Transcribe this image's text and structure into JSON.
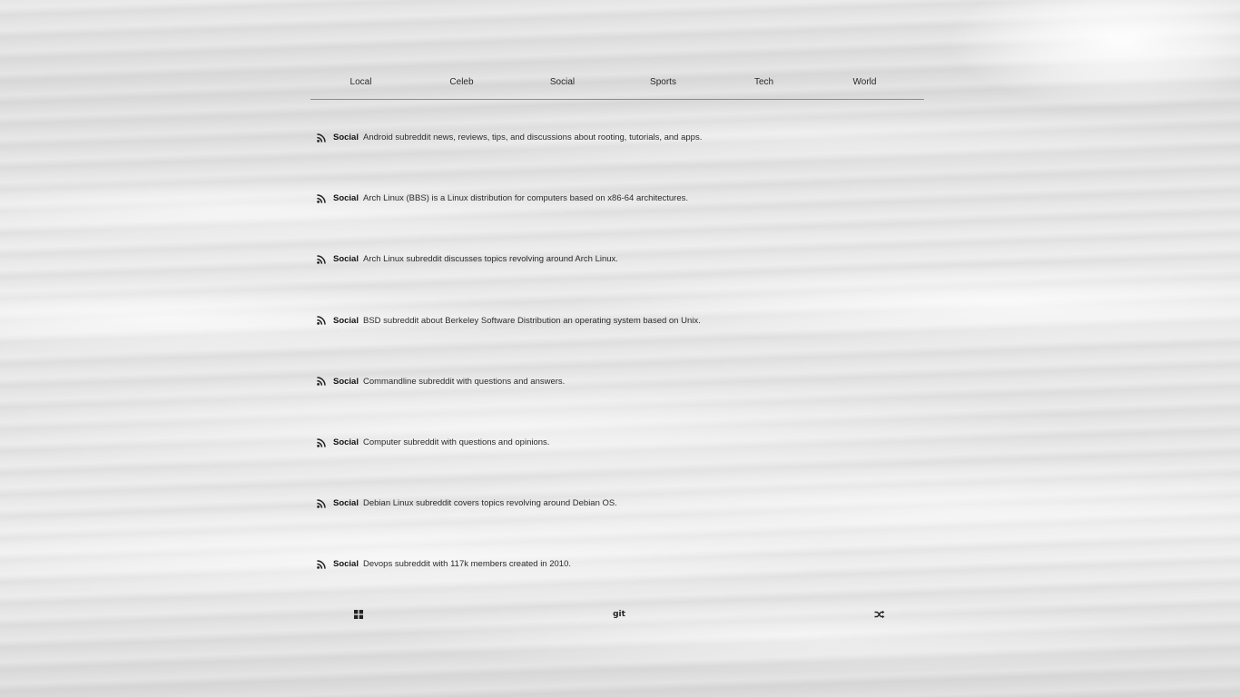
{
  "nav": {
    "tabs": [
      {
        "label": "Local"
      },
      {
        "label": "Celeb"
      },
      {
        "label": "Social"
      },
      {
        "label": "Sports"
      },
      {
        "label": "Tech"
      },
      {
        "label": "World"
      }
    ]
  },
  "feed": {
    "items": [
      {
        "icon": "rss-icon",
        "category": "Social",
        "description": "Android subreddit news, reviews, tips, and discussions about rooting, tutorials, and apps."
      },
      {
        "icon": "rss-icon",
        "category": "Social",
        "description": "Arch Linux (BBS) is a Linux distribution for computers based on x86-64 architectures."
      },
      {
        "icon": "rss-icon",
        "category": "Social",
        "description": "Arch Linux subreddit discusses topics revolving around Arch Linux."
      },
      {
        "icon": "rss-icon",
        "category": "Social",
        "description": "BSD subreddit about Berkeley Software Distribution an operating system based on Unix."
      },
      {
        "icon": "rss-icon",
        "category": "Social",
        "description": "Commandline subreddit with questions and answers."
      },
      {
        "icon": "rss-icon",
        "category": "Social",
        "description": "Computer subreddit with questions and opinions."
      },
      {
        "icon": "rss-icon",
        "category": "Social",
        "description": "Debian Linux subreddit covers topics revolving around Debian OS."
      },
      {
        "icon": "rss-icon",
        "category": "Social",
        "description": "Devops subreddit with 117k members created in 2010."
      }
    ]
  },
  "footer": {
    "grid_icon": "grid-icon",
    "git_label": "git",
    "shuffle_icon": "shuffle-icon"
  },
  "colors": {
    "text": "#1f1f1f",
    "divider": "#8c8c8c"
  }
}
